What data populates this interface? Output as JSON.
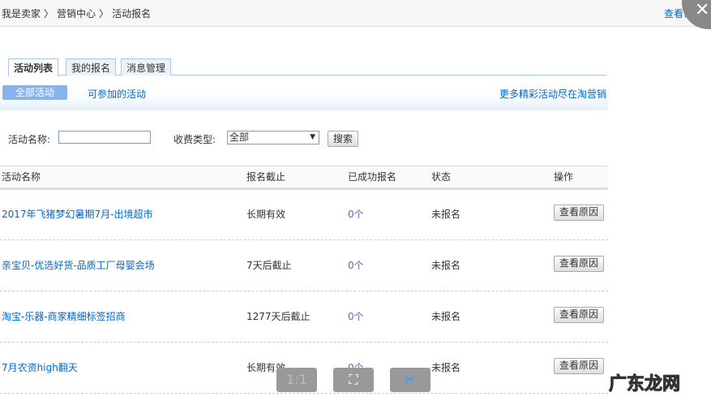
{
  "breadcrumb": [
    "我是卖家",
    "营销中心",
    "活动报名"
  ],
  "help": "查看帮助",
  "tabs": [
    "活动列表",
    "我的报名",
    "消息管理"
  ],
  "subnav": {
    "all": "全部活动",
    "available": "可参加的活动",
    "more": "更多精彩活动尽在淘营销"
  },
  "search": {
    "name_label": "活动名称:",
    "name_value": "",
    "fee_label": "收费类型:",
    "fee_value": "全部",
    "button": "搜索"
  },
  "table": {
    "headers": [
      "活动名称",
      "报名截止",
      "已成功报名",
      "状态",
      "操作"
    ],
    "rows": [
      {
        "name": "2017年飞猪梦幻暑期7月-出境超市",
        "deadline": "长期有效",
        "count": "0个",
        "status": "未报名",
        "action": "查看原因"
      },
      {
        "name": "亲宝贝-优选好货-品质工厂母婴会场",
        "deadline": "7天后截止",
        "count": "0个",
        "status": "未报名",
        "action": "查看原因"
      },
      {
        "name": "淘宝-乐器-商家精细标签招商",
        "deadline": "1277天后截止",
        "count": "0个",
        "status": "未报名",
        "action": "查看原因"
      },
      {
        "name": "7月农资high翻天",
        "deadline": "长期有效",
        "count": "0个",
        "status": "未报名",
        "action": "查看原因"
      }
    ]
  },
  "viewer": {
    "actual_size": "1:1"
  },
  "watermark": "广东龙网"
}
